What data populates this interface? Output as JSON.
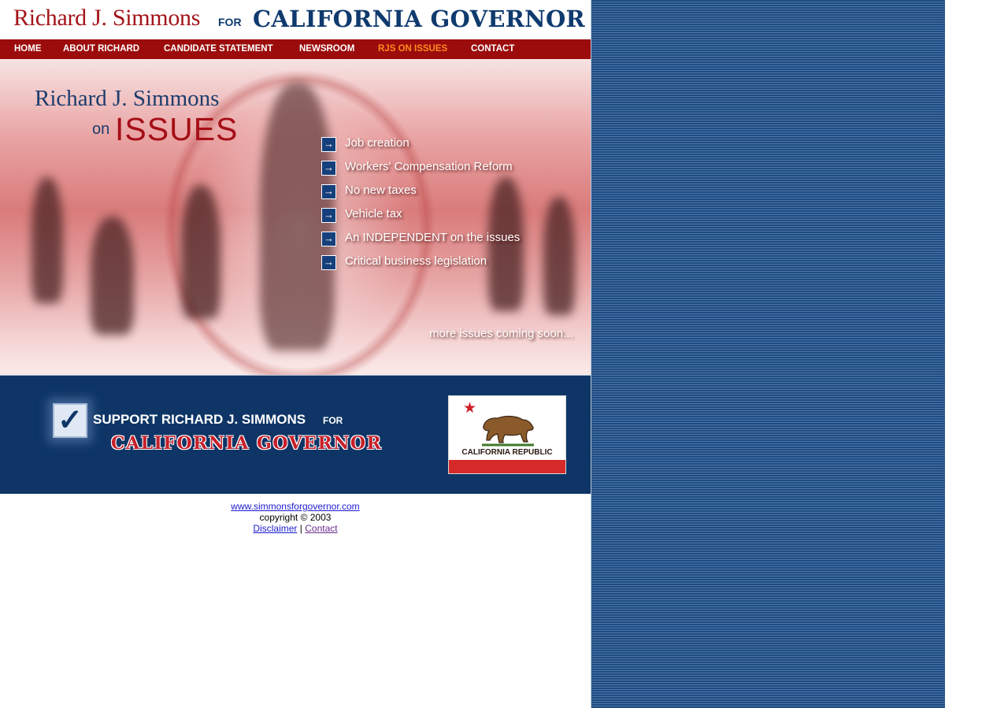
{
  "header": {
    "candidate_name": "Richard J. Simmons",
    "for_word": "FOR",
    "office": "CALIFORNIA GOVERNOR"
  },
  "nav": {
    "items": [
      {
        "label": "HOME"
      },
      {
        "label": "ABOUT RICHARD"
      },
      {
        "label": "CANDIDATE STATEMENT"
      },
      {
        "label": "NEWSROOM"
      },
      {
        "label": "RJS ON ISSUES",
        "active": true
      },
      {
        "label": "CONTACT"
      }
    ]
  },
  "hero": {
    "title_name": "Richard J. Simmons",
    "title_on": "on",
    "title_issues": "ISSUES",
    "issues": [
      {
        "label": "Job creation",
        "icon": "arrow-right-icon"
      },
      {
        "label": "Workers' Compensation Reform",
        "icon": "arrow-right-icon"
      },
      {
        "label": "No new taxes",
        "icon": "arrow-right-icon"
      },
      {
        "label": "Vehicle tax",
        "icon": "arrow-right-icon"
      },
      {
        "label": "An INDEPENDENT on the issues",
        "icon": "arrow-right-icon"
      },
      {
        "label": "Critical business legislation",
        "icon": "arrow-right-icon"
      }
    ],
    "more_text": "more issues coming soon..."
  },
  "support": {
    "line1": "SUPPORT RICHARD J. SIMMONS",
    "line1_for": "FOR",
    "line2": "CALIFORNIA GOVERNOR",
    "flag_caption": "CALIFORNIA REPUBLIC"
  },
  "footer": {
    "site_link": "www.simmonsforgovernor.com",
    "copyright": "copyright © 2003",
    "disclaimer": "Disclaimer",
    "separator": "|",
    "contact": "Contact"
  },
  "colors": {
    "nav_bg": "#9c0c0c",
    "nav_active": "#ff8a1e",
    "navy": "#0e3566",
    "brand_red": "#a31419"
  }
}
